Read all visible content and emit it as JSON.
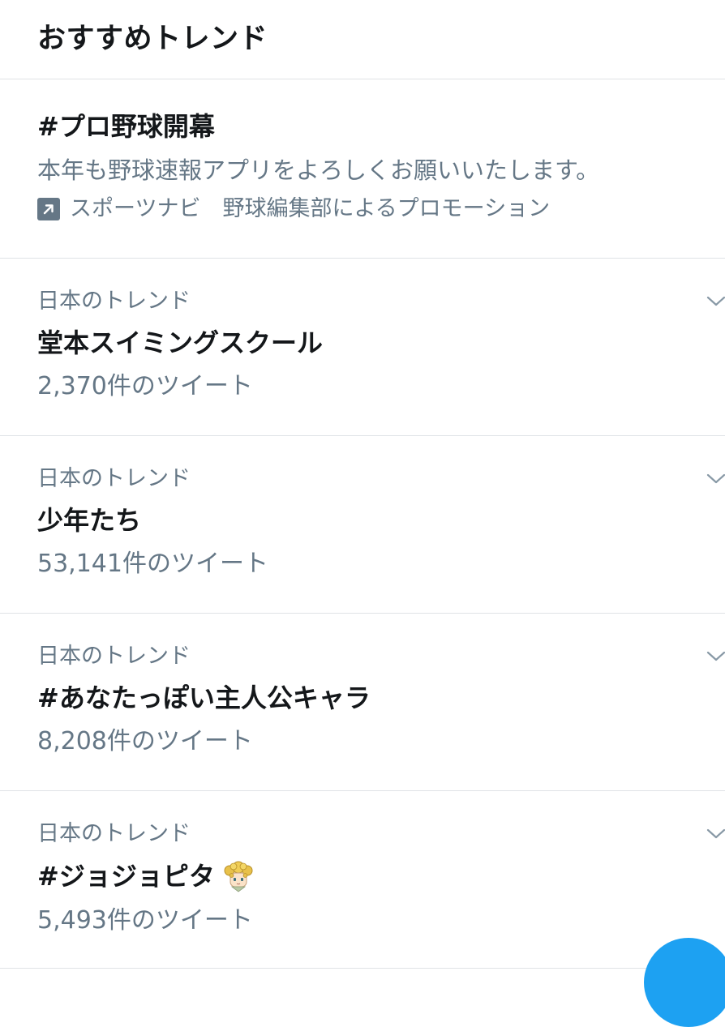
{
  "header": {
    "title": "おすすめトレンド"
  },
  "promo": {
    "title": "#プロ野球開幕",
    "description": "本年も野球速報アプリをよろしくお願いいたします。",
    "promoted_by": "スポーツナビ　野球編集部によるプロモーション",
    "icon": "promoted-arrow-icon"
  },
  "trends": [
    {
      "context": "日本のトレンド",
      "name": "堂本スイミングスクール",
      "count": "2,370件のツイート"
    },
    {
      "context": "日本のトレンド",
      "name": "少年たち",
      "count": "53,141件のツイート"
    },
    {
      "context": "日本のトレンド",
      "name": "#あなたっぽい主人公キャラ",
      "count": "8,208件のツイート"
    },
    {
      "context": "日本のトレンド",
      "name": "#ジョジョピタ",
      "count": "5,493件のツイート",
      "emoji": "jojo-character-emoji"
    }
  ],
  "colors": {
    "primary_text": "#14171a",
    "secondary_text": "#657786",
    "divider": "#dfe3e6",
    "accent": "#1da1f2"
  }
}
